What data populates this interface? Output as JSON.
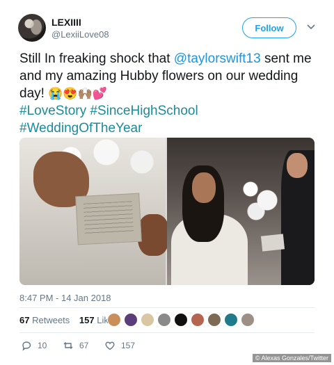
{
  "user": {
    "name": "LEXIIII",
    "handle": "@LexiiLove08"
  },
  "follow_label": "Follow",
  "tweet": {
    "line1_pre": "Still In freaking shock that ",
    "mention": "@taylorswift13",
    "line1_post": " sent me and my amazing Hubby flowers on our wedding day! ",
    "emojis": "😭😍🙌🏽💕",
    "hashtag1": "#LoveStory",
    "hashtag2": "#SinceHighSchool",
    "hashtag3": "#WeddingOfTheYear"
  },
  "timestamp": "8:47 PM - 14 Jan 2018",
  "stats": {
    "retweets_count": "67",
    "retweets_label": "Retweets",
    "likes_count": "157",
    "likes_label": "Likes"
  },
  "actions": {
    "replies": "10",
    "retweets": "67",
    "likes": "157"
  },
  "credit": "© Alexas Gonzales/Twitter",
  "colors": {
    "accent": "#1da1f2",
    "hashtag": "#1b8b9b",
    "muted": "#657786"
  }
}
